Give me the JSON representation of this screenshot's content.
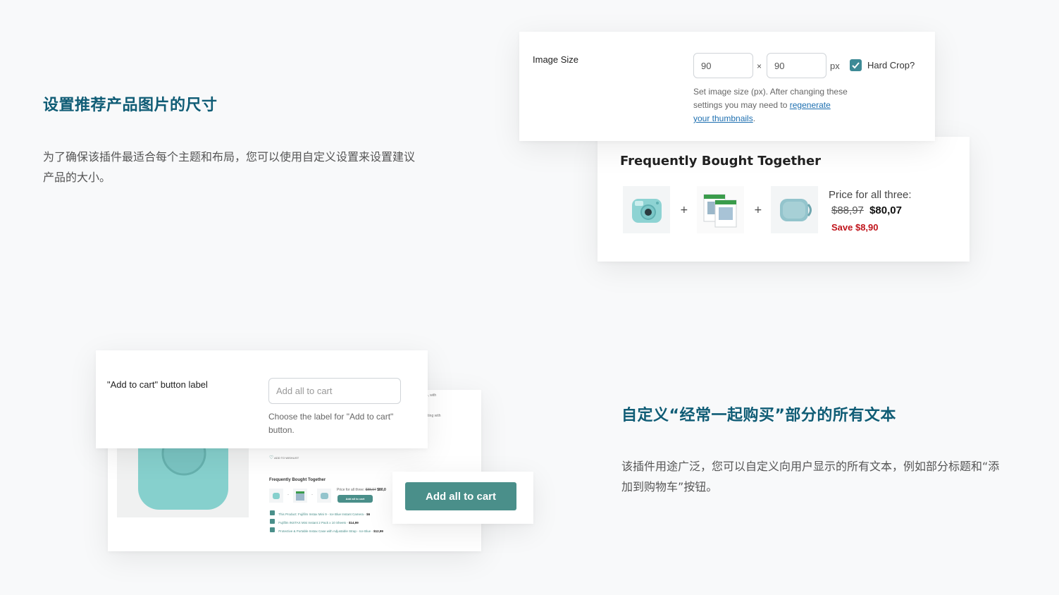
{
  "section1": {
    "heading": "设置推荐产品图片的尺寸",
    "paragraph_line1": "为了确保该插件最适合每个主题和布局，您可以使用自定义设置来设置建议",
    "paragraph_line2": "产品的大小。"
  },
  "image_size_card": {
    "label": "Image Size",
    "width_value": "90",
    "times": "×",
    "height_value": "90",
    "unit": "px",
    "hard_crop_label": "Hard Crop?",
    "hard_crop_checked": true,
    "help_line1": "Set image size (px). After changing these",
    "help_line2_prefix": "settings you may need to ",
    "help_link_part1": "regenerate",
    "help_link_part2": "your thumbnails",
    "help_suffix": "."
  },
  "fbt_card": {
    "title": "Frequently Bought Together",
    "plus": "+",
    "price_label": "Price for all three:",
    "old_price": "$88,97",
    "new_price": "$80,07",
    "save_text": "Save $8,90",
    "products": [
      "camera",
      "film-pack",
      "camera-case"
    ]
  },
  "section2": {
    "heading": "自定义“经常一起购买”部分的所有文本",
    "paragraph_line1": "该插件用途广泛，您可以自定义向用户显示的所有文本，例如部分标题和“添",
    "paragraph_line2": "加到购物车”按钮。"
  },
  "label_card": {
    "label": "\"Add to cart\" button label",
    "placeholder": "Add all to cart",
    "help_line1": "Choose the label for \"Add to cart\"",
    "help_line2": "button."
  },
  "mini_page": {
    "right_text1": "%, with",
    "right_text2": "etting with",
    "wishlist": "ADD TO WISHLIST",
    "fbt_title": "Frequently Bought Together",
    "price_label": "Price for all three:",
    "old_price": "$88,97",
    "new_price": "$80,0",
    "small_button": "Add all to cart",
    "items": [
      {
        "text": "This Product: Fujifilm Instax Mini 9 - Ice Blue Instant Camera - ",
        "price": "$6"
      },
      {
        "text": "Fujifilm INSTAX Mini Instant 2 Pack x 10 Sheets - ",
        "price": "$14,99"
      },
      {
        "text": "Protective & Portable Instax Case with Adjustable Strap - Ice Blue - ",
        "price": "$12,99"
      }
    ]
  },
  "big_button": {
    "label": "Add all to cart"
  },
  "colors": {
    "heading": "#0f5c75",
    "accent_teal": "#4a8f8a",
    "save_red": "#c0141b",
    "checkbox": "#3d8a96"
  }
}
